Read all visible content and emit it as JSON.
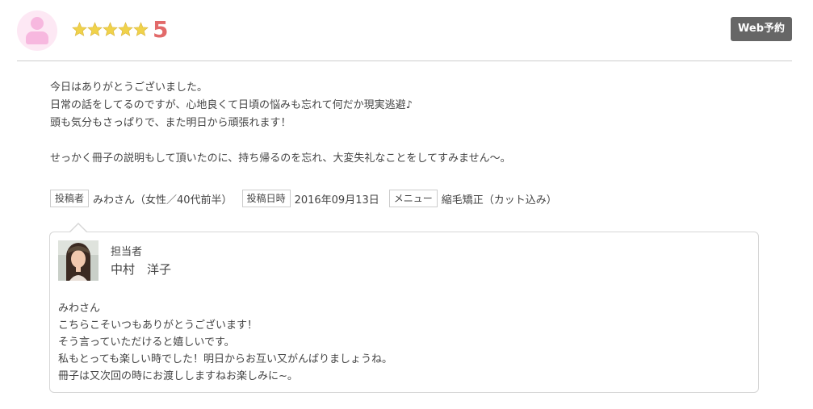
{
  "review": {
    "rating_value": "5",
    "rating_stars": 5,
    "star_color": "#f0d24a",
    "web_button_label": "Web予約",
    "body_lines": [
      "今日はありがとうございました。",
      "日常の話をしてるのですが、心地良くて日頃の悩みも忘れて何だか現実逃避♪",
      "頭も気分もさっぱりで、また明日から頑張れます！",
      "",
      "せっかく冊子の説明もして頂いたのに、持ち帰るのを忘れ、大変失礼なことをしてすみません〜。"
    ],
    "meta": {
      "poster_tag": "投稿者",
      "poster_value": "みわさん（女性／40代前半）",
      "date_tag": "投稿日時",
      "date_value": "2016年09月13日",
      "menu_tag": "メニュー",
      "menu_value": "縮毛矯正（カット込み）"
    }
  },
  "reply": {
    "role_label": "担当者",
    "staff_name": "中村　洋子",
    "lines": [
      "みわさん",
      "こちらこそいつもありがとうございます！",
      "そう言っていただけると嬉しいです。",
      "私もとっても楽しい時でした！明日からお互い又がんばりましょうね。",
      "冊子は又次回の時にお渡ししますねお楽しみに~。"
    ]
  }
}
